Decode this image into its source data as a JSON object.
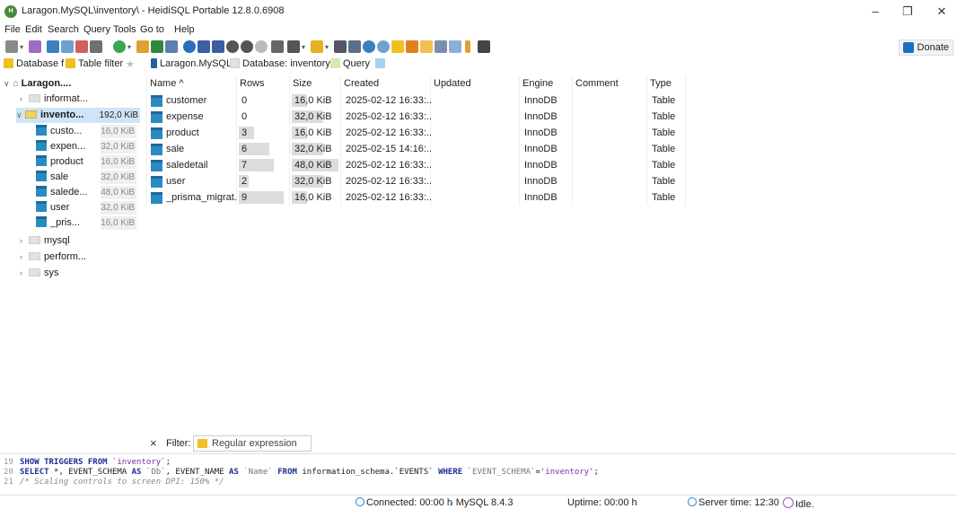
{
  "window": {
    "title": "Laragon.MySQL\\inventory\\ - HeidiSQL Portable 12.8.0.6908",
    "minimize": "–",
    "maximize": "❐",
    "close": "✕"
  },
  "menu": [
    "File",
    "Edit",
    "Search",
    "Query",
    "Tools",
    "Go to",
    "Help"
  ],
  "toolbar": {
    "donate_label": "Donate"
  },
  "tabs": {
    "database_filter": "Database f",
    "table_filter": "Table filter",
    "host": "Laragon.MySQL",
    "database": "Database: inventory",
    "query": "Query"
  },
  "tree": {
    "root": "Laragon....",
    "databases": [
      {
        "name": "informat..."
      },
      {
        "name": "invento...",
        "size": "192,0 KiB"
      },
      {
        "name": "mysql"
      },
      {
        "name": "perform..."
      },
      {
        "name": "sys"
      }
    ],
    "tables": [
      {
        "name": "custo...",
        "size": "16,0 KiB"
      },
      {
        "name": "expen...",
        "size": "32,0 KiB"
      },
      {
        "name": "product",
        "size": "16,0 KiB"
      },
      {
        "name": "sale",
        "size": "32,0 KiB"
      },
      {
        "name": "salede...",
        "size": "48,0 KiB"
      },
      {
        "name": "user",
        "size": "32,0 KiB"
      },
      {
        "name": "_pris...",
        "size": "16,0 KiB"
      }
    ]
  },
  "grid": {
    "columns": [
      "Name ^",
      "Rows",
      "Size",
      "Created",
      "Updated",
      "Engine",
      "Comment",
      "Type"
    ],
    "rows": [
      {
        "name": "customer",
        "rows": "0",
        "size": "16,0 KiB",
        "created": "2025-02-12 16:33:...",
        "updated": "",
        "engine": "InnoDB",
        "comment": "",
        "type": "Table",
        "rows_frac": 0.0,
        "size_frac": 0.33
      },
      {
        "name": "expense",
        "rows": "0",
        "size": "32,0 KiB",
        "created": "2025-02-12 16:33:...",
        "updated": "",
        "engine": "InnoDB",
        "comment": "",
        "type": "Table",
        "rows_frac": 0.0,
        "size_frac": 0.67
      },
      {
        "name": "product",
        "rows": "3",
        "size": "16,0 KiB",
        "created": "2025-02-12 16:33:...",
        "updated": "",
        "engine": "InnoDB",
        "comment": "",
        "type": "Table",
        "rows_frac": 0.33,
        "size_frac": 0.33
      },
      {
        "name": "sale",
        "rows": "6",
        "size": "32,0 KiB",
        "created": "2025-02-15 14:16:...",
        "updated": "",
        "engine": "InnoDB",
        "comment": "",
        "type": "Table",
        "rows_frac": 0.67,
        "size_frac": 0.67
      },
      {
        "name": "saledetail",
        "rows": "7",
        "size": "48,0 KiB",
        "created": "2025-02-12 16:33:...",
        "updated": "",
        "engine": "InnoDB",
        "comment": "",
        "type": "Table",
        "rows_frac": 0.78,
        "size_frac": 1.0
      },
      {
        "name": "user",
        "rows": "2",
        "size": "32,0 KiB",
        "created": "2025-02-12 16:33:...",
        "updated": "",
        "engine": "InnoDB",
        "comment": "",
        "type": "Table",
        "rows_frac": 0.22,
        "size_frac": 0.67
      },
      {
        "name": "_prisma_migrat...",
        "rows": "9",
        "size": "16,0 KiB",
        "created": "2025-02-12 16:33:...",
        "updated": "",
        "engine": "InnoDB",
        "comment": "",
        "type": "Table",
        "rows_frac": 1.0,
        "size_frac": 0.33
      }
    ]
  },
  "filter": {
    "label": "Filter:",
    "placeholder": "Regular expression",
    "close": "×"
  },
  "sql_log": {
    "line_numbers": [
      "19",
      "20",
      "21"
    ],
    "line19": {
      "kw": "SHOW TRIGGERS FROM",
      "db": "`inventory`",
      "end": ";"
    },
    "line20": {
      "kw1": "SELECT",
      "p1": "*, EVENT_SCHEMA",
      "kw2": "AS",
      "id1": "`Db`",
      "p2": ", EVENT_NAME",
      "kw3": "AS",
      "id2": "`Name`",
      "kw4": "FROM",
      "p3": "information_schema.`EVENTS`",
      "kw5": "WHERE",
      "id3": "`EVENT_SCHEMA`",
      "p4": "=",
      "str": "'inventory'",
      "end": ";"
    },
    "line21": "/* Scaling controls to screen DPI: 150% */"
  },
  "status": {
    "connected": "Connected: 00:00 h",
    "server_version": "MySQL 8.4.3",
    "uptime": "Uptime: 00:00 h",
    "server_time": "Server time: 12:30",
    "state": "Idle."
  },
  "colors": {
    "accent": "#2a8bc2",
    "selection": "#cfe4f7",
    "keyword": "#1f2c8f",
    "string": "#7a2aa6"
  }
}
